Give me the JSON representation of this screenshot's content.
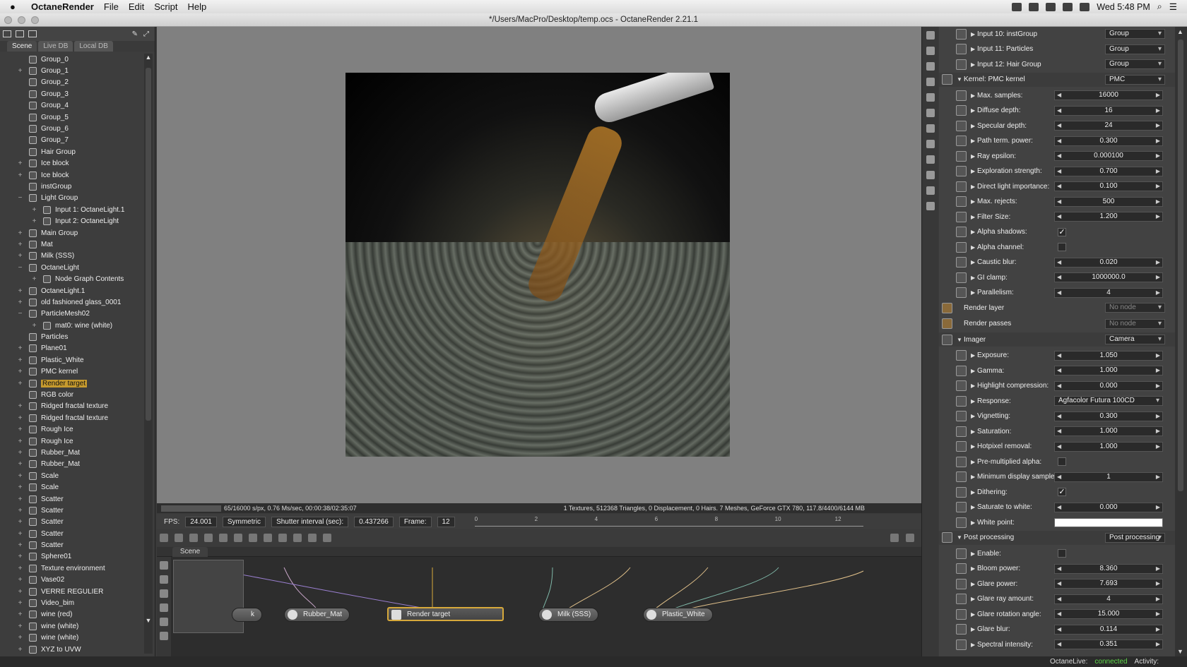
{
  "menubar": {
    "app": "OctaneRender",
    "items": [
      "File",
      "Edit",
      "Script",
      "Help"
    ],
    "clock": "Wed 5:48 PM"
  },
  "titlebar": {
    "title": "*/Users/MacPro/Desktop/temp.ocs - OctaneRender 2.21.1"
  },
  "leftpanel": {
    "tabs": [
      "Scene",
      "Live DB",
      "Local DB"
    ],
    "tree": [
      {
        "label": "Group_0",
        "exp": "",
        "lvl": 0
      },
      {
        "label": "Group_1",
        "exp": "+",
        "lvl": 0
      },
      {
        "label": "Group_2",
        "exp": "",
        "lvl": 0
      },
      {
        "label": "Group_3",
        "exp": "",
        "lvl": 0
      },
      {
        "label": "Group_4",
        "exp": "",
        "lvl": 0
      },
      {
        "label": "Group_5",
        "exp": "",
        "lvl": 0
      },
      {
        "label": "Group_6",
        "exp": "",
        "lvl": 0
      },
      {
        "label": "Group_7",
        "exp": "",
        "lvl": 0
      },
      {
        "label": "Hair Group",
        "exp": "",
        "lvl": 0
      },
      {
        "label": "Ice block",
        "exp": "+",
        "lvl": 0
      },
      {
        "label": "Ice block",
        "exp": "+",
        "lvl": 0
      },
      {
        "label": "instGroup",
        "exp": "",
        "lvl": 0
      },
      {
        "label": "Light Group",
        "exp": "−",
        "lvl": 0
      },
      {
        "label": "Input 1: OctaneLight.1",
        "exp": "+",
        "lvl": 1
      },
      {
        "label": "Input 2: OctaneLight",
        "exp": "+",
        "lvl": 1
      },
      {
        "label": "Main Group",
        "exp": "+",
        "lvl": 0
      },
      {
        "label": "Mat",
        "exp": "+",
        "lvl": 0
      },
      {
        "label": "Milk (SSS)",
        "exp": "+",
        "lvl": 0
      },
      {
        "label": "OctaneLight",
        "exp": "−",
        "lvl": 0
      },
      {
        "label": "Node Graph Contents",
        "exp": "+",
        "lvl": 1
      },
      {
        "label": "OctaneLight.1",
        "exp": "+",
        "lvl": 0
      },
      {
        "label": "old fashioned glass_0001",
        "exp": "+",
        "lvl": 0
      },
      {
        "label": "ParticleMesh02",
        "exp": "−",
        "lvl": 0
      },
      {
        "label": "mat0: wine (white)",
        "exp": "+",
        "lvl": 1
      },
      {
        "label": "Particles",
        "exp": "",
        "lvl": 0
      },
      {
        "label": "Plane01",
        "exp": "+",
        "lvl": 0
      },
      {
        "label": "Plastic_White",
        "exp": "+",
        "lvl": 0
      },
      {
        "label": "PMC kernel",
        "exp": "+",
        "lvl": 0
      },
      {
        "label": "Render target",
        "exp": "+",
        "lvl": 0,
        "sel": true
      },
      {
        "label": "RGB color",
        "exp": "",
        "lvl": 0
      },
      {
        "label": "Ridged fractal texture",
        "exp": "+",
        "lvl": 0
      },
      {
        "label": "Ridged fractal texture",
        "exp": "+",
        "lvl": 0
      },
      {
        "label": "Rough Ice",
        "exp": "+",
        "lvl": 0
      },
      {
        "label": "Rough Ice",
        "exp": "+",
        "lvl": 0
      },
      {
        "label": "Rubber_Mat",
        "exp": "+",
        "lvl": 0
      },
      {
        "label": "Rubber_Mat",
        "exp": "+",
        "lvl": 0
      },
      {
        "label": "Scale",
        "exp": "+",
        "lvl": 0
      },
      {
        "label": "Scale",
        "exp": "+",
        "lvl": 0
      },
      {
        "label": "Scatter",
        "exp": "+",
        "lvl": 0
      },
      {
        "label": "Scatter",
        "exp": "+",
        "lvl": 0
      },
      {
        "label": "Scatter",
        "exp": "+",
        "lvl": 0
      },
      {
        "label": "Scatter",
        "exp": "+",
        "lvl": 0
      },
      {
        "label": "Scatter",
        "exp": "+",
        "lvl": 0
      },
      {
        "label": "Sphere01",
        "exp": "+",
        "lvl": 0
      },
      {
        "label": "Texture environment",
        "exp": "+",
        "lvl": 0
      },
      {
        "label": "Vase02",
        "exp": "+",
        "lvl": 0
      },
      {
        "label": "VERRE REGULIER",
        "exp": "+",
        "lvl": 0
      },
      {
        "label": "Video_bim",
        "exp": "+",
        "lvl": 0
      },
      {
        "label": "wine (red)",
        "exp": "+",
        "lvl": 0
      },
      {
        "label": "wine (white)",
        "exp": "+",
        "lvl": 0
      },
      {
        "label": "wine (white)",
        "exp": "+",
        "lvl": 0
      },
      {
        "label": "XYZ to UVW",
        "exp": "+",
        "lvl": 0
      }
    ]
  },
  "status": {
    "left": "65/16000 s/px, 0.76 Ms/sec, 00:00:38/02:35:07",
    "right": "1 Textures, 512368 Triangles, 0 Displacement, 0 Hairs. 7 Meshes, GeForce GTX 780, 117.8/4400/6144 MB"
  },
  "controls": {
    "fps_label": "FPS:",
    "fps": "24.001",
    "mode": "Symmetric",
    "shutter_label": "Shutter interval (sec):",
    "shutter": "0.437266",
    "frame_label": "Frame:",
    "frame": "12",
    "ticks": [
      "0",
      "2",
      "4",
      "6",
      "8",
      "10",
      "12"
    ]
  },
  "nodegraph": {
    "tab": "Scene",
    "nodes": [
      "k",
      "Rubber_Mat",
      "Render target",
      "Milk (SSS)",
      "Plastic_White"
    ]
  },
  "rightpanel": {
    "rows": [
      {
        "type": "dd",
        "label": "Input 10: instGroup",
        "value": "Group",
        "indent": 1
      },
      {
        "type": "dd",
        "label": "Input 11: Particles",
        "value": "Group",
        "indent": 1
      },
      {
        "type": "dd",
        "label": "Input 12: Hair Group",
        "value": "Group",
        "indent": 1
      },
      {
        "type": "hdr",
        "label": "Kernel: PMC kernel",
        "value": "PMC"
      },
      {
        "type": "num",
        "label": "Max. samples:",
        "value": "16000"
      },
      {
        "type": "num",
        "label": "Diffuse depth:",
        "value": "16"
      },
      {
        "type": "num",
        "label": "Specular depth:",
        "value": "24"
      },
      {
        "type": "num",
        "label": "Path term. power:",
        "value": "0.300"
      },
      {
        "type": "num",
        "label": "Ray epsilon:",
        "value": "0.000100"
      },
      {
        "type": "num",
        "label": "Exploration strength:",
        "value": "0.700"
      },
      {
        "type": "num",
        "label": "Direct light importance:",
        "value": "0.100"
      },
      {
        "type": "num",
        "label": "Max. rejects:",
        "value": "500"
      },
      {
        "type": "num",
        "label": "Filter Size:",
        "value": "1.200"
      },
      {
        "type": "chk",
        "label": "Alpha shadows:",
        "value": "✓"
      },
      {
        "type": "chk",
        "label": "Alpha channel:",
        "value": ""
      },
      {
        "type": "num",
        "label": "Caustic blur:",
        "value": "0.020"
      },
      {
        "type": "num",
        "label": "GI clamp:",
        "value": "1000000.0"
      },
      {
        "type": "num",
        "label": "Parallelism:",
        "value": "4"
      },
      {
        "type": "top",
        "label": "Render layer",
        "value": "No node"
      },
      {
        "type": "top",
        "label": "Render passes",
        "value": "No node"
      },
      {
        "type": "hdr",
        "label": "Imager",
        "value": "Camera"
      },
      {
        "type": "num",
        "label": "Exposure:",
        "value": "1.050"
      },
      {
        "type": "num",
        "label": "Gamma:",
        "value": "1.000"
      },
      {
        "type": "num",
        "label": "Highlight compression:",
        "value": "0.000"
      },
      {
        "type": "ddw",
        "label": "Response:",
        "value": "Agfacolor Futura 100CD"
      },
      {
        "type": "num",
        "label": "Vignetting:",
        "value": "0.300"
      },
      {
        "type": "num",
        "label": "Saturation:",
        "value": "1.000"
      },
      {
        "type": "num",
        "label": "Hotpixel removal:",
        "value": "1.000"
      },
      {
        "type": "chk",
        "label": "Pre-multiplied alpha:",
        "value": ""
      },
      {
        "type": "num",
        "label": "Minimum display samples:",
        "value": "1"
      },
      {
        "type": "chk",
        "label": "Dithering:",
        "value": "✓"
      },
      {
        "type": "num",
        "label": "Saturate to white:",
        "value": "0.000"
      },
      {
        "type": "white",
        "label": "White point:",
        "value": ""
      },
      {
        "type": "hdr",
        "label": "Post processing",
        "value": "Post processing"
      },
      {
        "type": "chk",
        "label": "Enable:",
        "value": ""
      },
      {
        "type": "num",
        "label": "Bloom power:",
        "value": "8.360"
      },
      {
        "type": "num",
        "label": "Glare power:",
        "value": "7.693"
      },
      {
        "type": "num",
        "label": "Glare ray amount:",
        "value": "4"
      },
      {
        "type": "num",
        "label": "Glare rotation angle:",
        "value": "15.000"
      },
      {
        "type": "num",
        "label": "Glare blur:",
        "value": "0.114"
      },
      {
        "type": "num",
        "label": "Spectral intensity:",
        "value": "0.351"
      }
    ]
  },
  "bottombar": {
    "live_label": "OctaneLive:",
    "live_status": "connected",
    "activity": "Activity:"
  }
}
